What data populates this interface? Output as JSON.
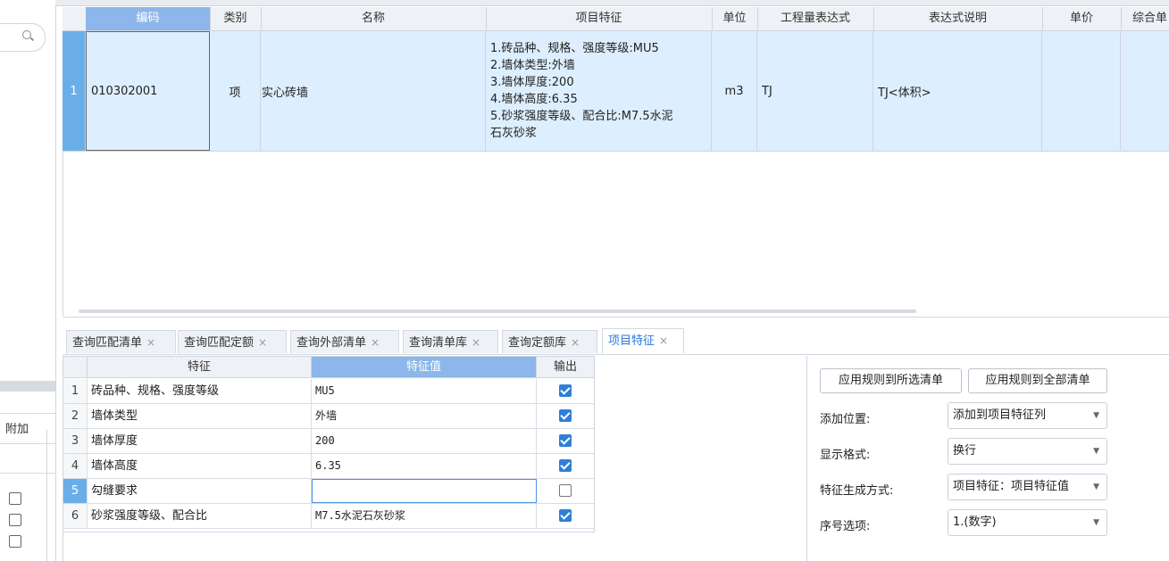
{
  "main_table": {
    "columns": [
      "编码",
      "类别",
      "名称",
      "项目特征",
      "单位",
      "工程量表达式",
      "表达式说明",
      "单价",
      "综合单"
    ],
    "rows": [
      {
        "num": "1",
        "code": "010302001",
        "category": "项",
        "name": "实心砖墙",
        "features": "1.砖品种、规格、强度等级:MU5\n2.墙体类型:外墙\n3.墙体厚度:200\n4.墙体高度:6.35\n5.砂浆强度等级、配合比:M7.5水泥\n石灰砂浆",
        "unit": "m3",
        "expr": "TJ",
        "expr_desc": "TJ<体积>",
        "unit_price": "",
        "total": ""
      }
    ]
  },
  "tabs": [
    {
      "label": "查询匹配清单",
      "close": "×"
    },
    {
      "label": "查询匹配定额",
      "close": "×"
    },
    {
      "label": "查询外部清单",
      "close": "×"
    },
    {
      "label": "查询清单库",
      "close": "×"
    },
    {
      "label": "查询定额库",
      "close": "×"
    },
    {
      "label": "项目特征",
      "close": "×"
    }
  ],
  "feature_grid": {
    "columns": [
      "特征",
      "特征值",
      "输出"
    ],
    "rows": [
      {
        "num": "1",
        "feature": "砖品种、规格、强度等级",
        "value": "MU5",
        "output": true
      },
      {
        "num": "2",
        "feature": "墙体类型",
        "value": "外墙",
        "output": true
      },
      {
        "num": "3",
        "feature": "墙体厚度",
        "value": "200",
        "output": true
      },
      {
        "num": "4",
        "feature": "墙体高度",
        "value": "6.35",
        "output": true
      },
      {
        "num": "5",
        "feature": "勾缝要求",
        "value": "",
        "output": false
      },
      {
        "num": "6",
        "feature": "砂浆强度等级、配合比",
        "value": "M7.5水泥石灰砂浆",
        "output": true
      }
    ]
  },
  "settings": {
    "apply_selected": "应用规则到所选清单",
    "apply_all": "应用规则到全部清单",
    "add_position_label": "添加位置:",
    "add_position_value": "添加到项目特征列",
    "display_format_label": "显示格式:",
    "display_format_value": "换行",
    "gen_method_label": "特征生成方式:",
    "gen_method_value": "项目特征：项目特征值",
    "seq_label": "序号选项:",
    "seq_value": "1.(数字)"
  },
  "left_panel": {
    "fujia_label": "附加"
  }
}
